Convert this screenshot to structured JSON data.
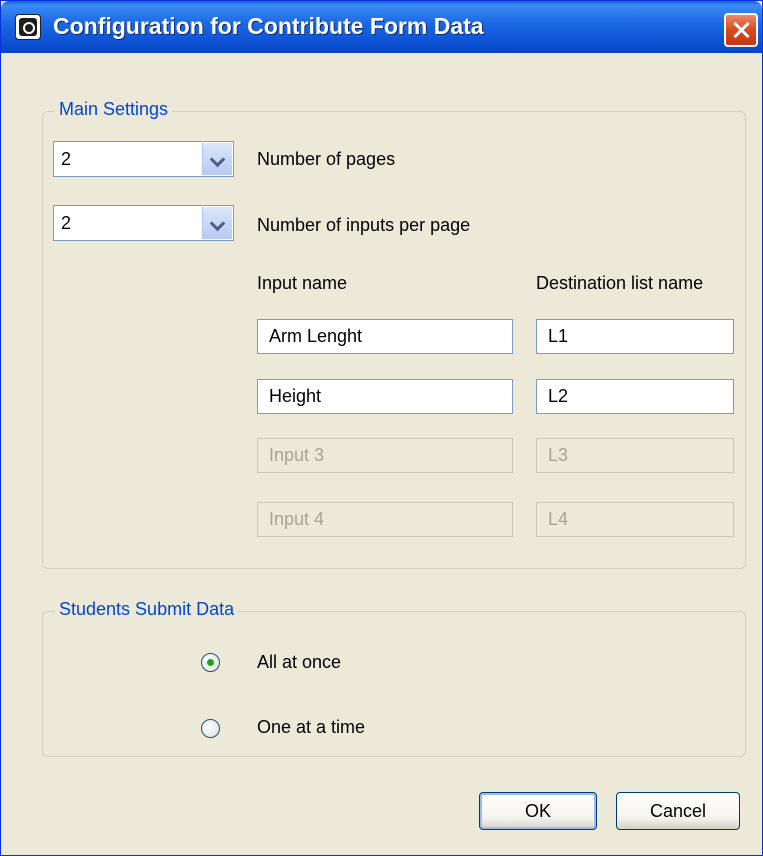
{
  "window": {
    "title": "Configuration for Contribute Form Data"
  },
  "main_settings": {
    "legend": "Main Settings",
    "pages": {
      "value": "2",
      "label": "Number of pages"
    },
    "inputs_per_page": {
      "value": "2",
      "label": "Number of inputs per page"
    },
    "col_input_name": "Input name",
    "col_destination": "Destination list name",
    "rows": [
      {
        "input_name": "Arm Lenght",
        "list_name": "L1",
        "enabled": true
      },
      {
        "input_name": "Height",
        "list_name": "L2",
        "enabled": true
      },
      {
        "input_placeholder": "Input 3",
        "list_placeholder": "L3",
        "enabled": false
      },
      {
        "input_placeholder": "Input 4",
        "list_placeholder": "L4",
        "enabled": false
      }
    ]
  },
  "submit": {
    "legend": "Students Submit Data",
    "options": [
      {
        "label": "All at once",
        "selected": true
      },
      {
        "label": "One at a time",
        "selected": false
      }
    ]
  },
  "buttons": {
    "ok": "OK",
    "cancel": "Cancel"
  },
  "colors": {
    "title_bar": "#1d6ae6",
    "legend": "#0046d5",
    "dialog_bg": "#ece9d8",
    "radio_dot": "#21a121"
  },
  "icons": [
    "app-icon",
    "close-icon",
    "chevron-down-icon"
  ]
}
